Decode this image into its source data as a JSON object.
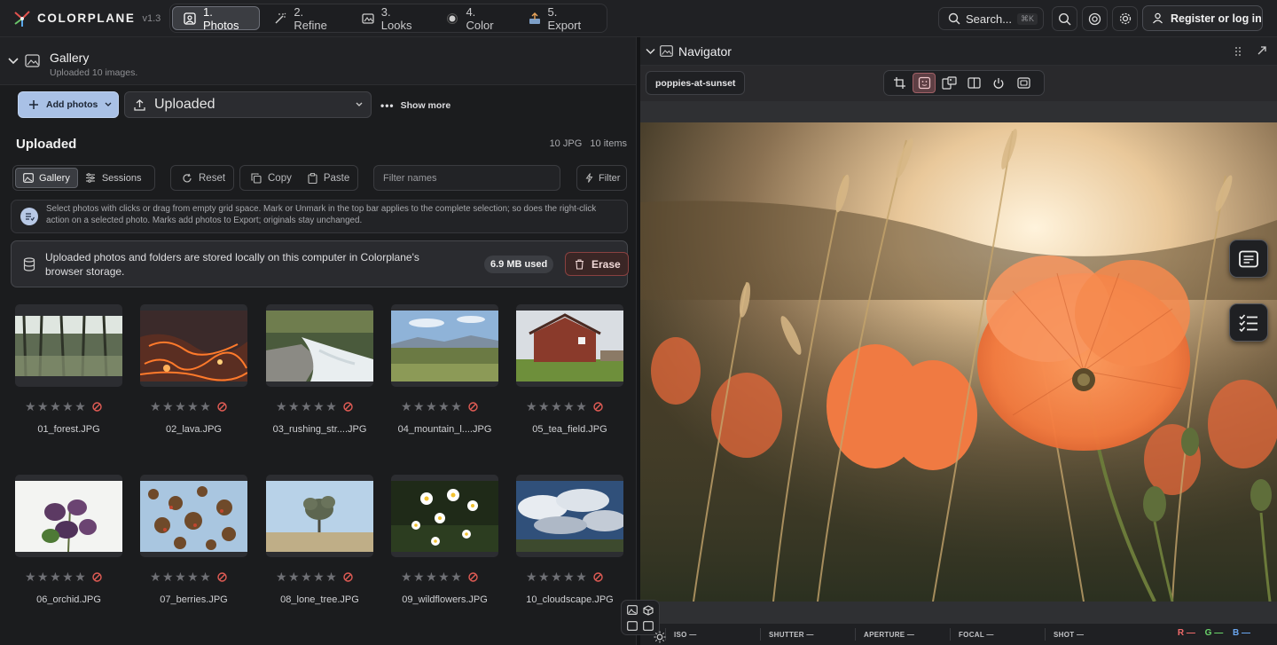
{
  "app": {
    "name": "COLORPLANE",
    "version": "v1.3"
  },
  "steps": [
    {
      "label": "1. Photos",
      "icon": "photo-icon",
      "active": true
    },
    {
      "label": "2. Refine",
      "icon": "magic-wand-icon",
      "active": false
    },
    {
      "label": "3. Looks",
      "icon": "looks-icon",
      "active": false
    },
    {
      "label": "4. Color",
      "icon": "color-dot-icon",
      "active": false
    },
    {
      "label": "5. Export",
      "icon": "export-icon",
      "active": false
    }
  ],
  "search": {
    "label": "Search...",
    "shortcut": "⌘K"
  },
  "auth": {
    "label": "Register or log in"
  },
  "gallery": {
    "title": "Gallery",
    "subtitle": "Uploaded 10 images.",
    "add_label": "Add photos",
    "source_label": "Uploaded",
    "show_more": "Show more",
    "section_title": "Uploaded",
    "counts": "10 JPG   10 items",
    "tabs": {
      "gallery": "Gallery",
      "sessions": "Sessions"
    },
    "actions": {
      "reset": "Reset",
      "copy": "Copy",
      "paste": "Paste",
      "filter": "Filter"
    },
    "filter_placeholder": "Filter names",
    "help_text": "Select photos with clicks or drag from empty grid space. Mark or Unmark in the top bar applies to the complete selection; so does the right-click action on a selected photo. Marks add photos to Export; originals stay unchanged.",
    "storage_text": "Uploaded photos and folders are stored locally on this computer in Colorplane's browser storage.",
    "storage_used": "6.9 MB used",
    "erase_label": "Erase",
    "photos": [
      {
        "name": "01_forest.JPG",
        "rating": 0,
        "thumb": "forest"
      },
      {
        "name": "02_lava.JPG",
        "rating": 0,
        "thumb": "lava"
      },
      {
        "name": "03_rushing_str....JPG",
        "rating": 0,
        "thumb": "stream"
      },
      {
        "name": "04_mountain_l....JPG",
        "rating": 0,
        "thumb": "mountain"
      },
      {
        "name": "05_tea_field.JPG",
        "rating": 0,
        "thumb": "barn"
      },
      {
        "name": "06_orchid.JPG",
        "rating": 0,
        "thumb": "orchid"
      },
      {
        "name": "07_berries.JPG",
        "rating": 0,
        "thumb": "berries"
      },
      {
        "name": "08_lone_tree.JPG",
        "rating": 0,
        "thumb": "tree"
      },
      {
        "name": "09_wildflowers.JPG",
        "rating": 0,
        "thumb": "daisies"
      },
      {
        "name": "10_cloudscape.JPG",
        "rating": 0,
        "thumb": "clouds"
      }
    ]
  },
  "navigator": {
    "title": "Navigator",
    "image_name": "poppies-at-sunset",
    "exif": {
      "iso": "ISO —",
      "shutter": "SHUTTER —",
      "aperture": "APERTURE —",
      "focal": "FOCAL —",
      "shot": "SHOT —"
    },
    "rgb": {
      "r": "R —",
      "g": "G —",
      "b": "B —"
    }
  },
  "colors": {
    "accent": "#a9c1e6",
    "danger": "#8a4140",
    "active_tool": "#a06066"
  }
}
